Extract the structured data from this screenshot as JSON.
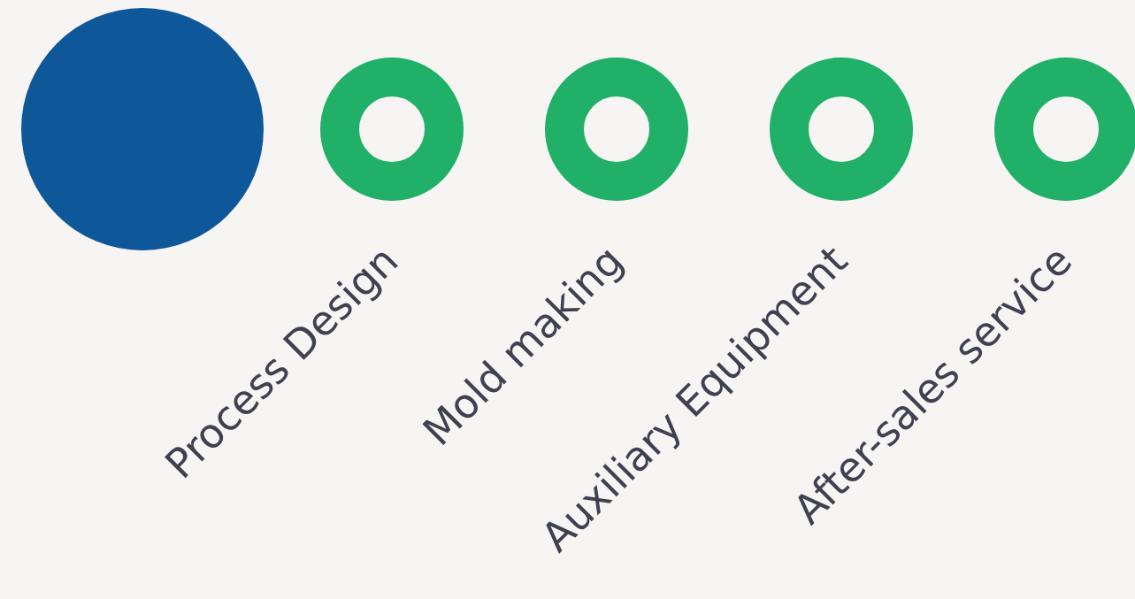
{
  "steps": [
    {
      "label": "Process Design"
    },
    {
      "label": "Mold making"
    },
    {
      "label": "Auxiliary Equipment"
    },
    {
      "label": "After-sales service"
    }
  ]
}
